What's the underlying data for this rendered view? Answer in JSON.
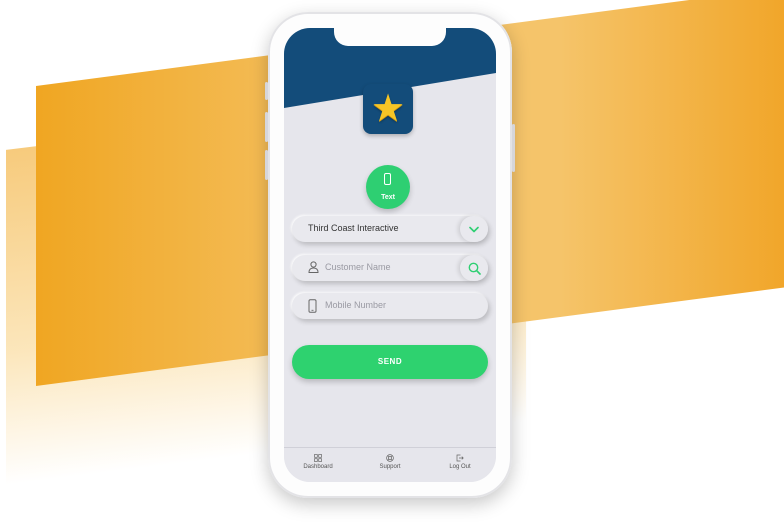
{
  "colors": {
    "header": "#134c7a",
    "accent_green": "#2ecf72",
    "screen_bg": "#e6e6ec",
    "band_orange": "#f0a622"
  },
  "app": {
    "icon": "star-icon"
  },
  "badge": {
    "label": "Text",
    "icon": "phone-icon"
  },
  "form": {
    "company_select": {
      "value": "Third Coast Interactive",
      "icon": "chevron-down-icon"
    },
    "customer_name": {
      "placeholder": "Customer Name",
      "icon": "user-icon",
      "action_icon": "search-icon"
    },
    "mobile_number": {
      "placeholder": "Mobile Number",
      "icon": "phone-icon"
    },
    "send_label": "SEND"
  },
  "nav": {
    "items": [
      {
        "label": "Dashboard",
        "icon": "grid-icon"
      },
      {
        "label": "Support",
        "icon": "lifebuoy-icon"
      },
      {
        "label": "Log Out",
        "icon": "logout-icon"
      }
    ]
  }
}
